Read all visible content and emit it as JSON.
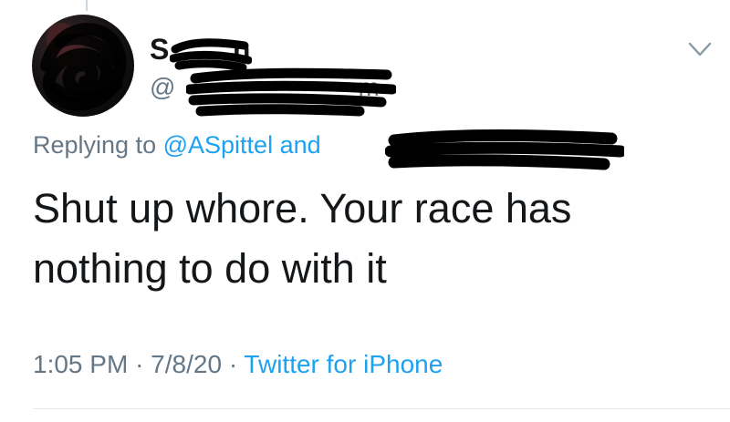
{
  "tweet": {
    "user": {
      "display_name": "S",
      "display_name_tail": "n",
      "handle": "@",
      "handle_tail": "m"
    },
    "reply": {
      "prefix": "Replying to",
      "mention": "@ASpittel",
      "conjunction": "and"
    },
    "text_line1": "Shut up whore. Your race has",
    "text_line2": "nothing to do with it",
    "time": "1:05 PM",
    "date": "7/8/20",
    "separator": "·",
    "source": "Twitter for iPhone"
  },
  "colors": {
    "link": "#1da1f2",
    "secondary_text": "#657786",
    "primary_text": "#14171a",
    "divider": "#e1e8ed"
  },
  "icons": {
    "menu": "chevron-down-icon",
    "avatar": "avatar"
  }
}
